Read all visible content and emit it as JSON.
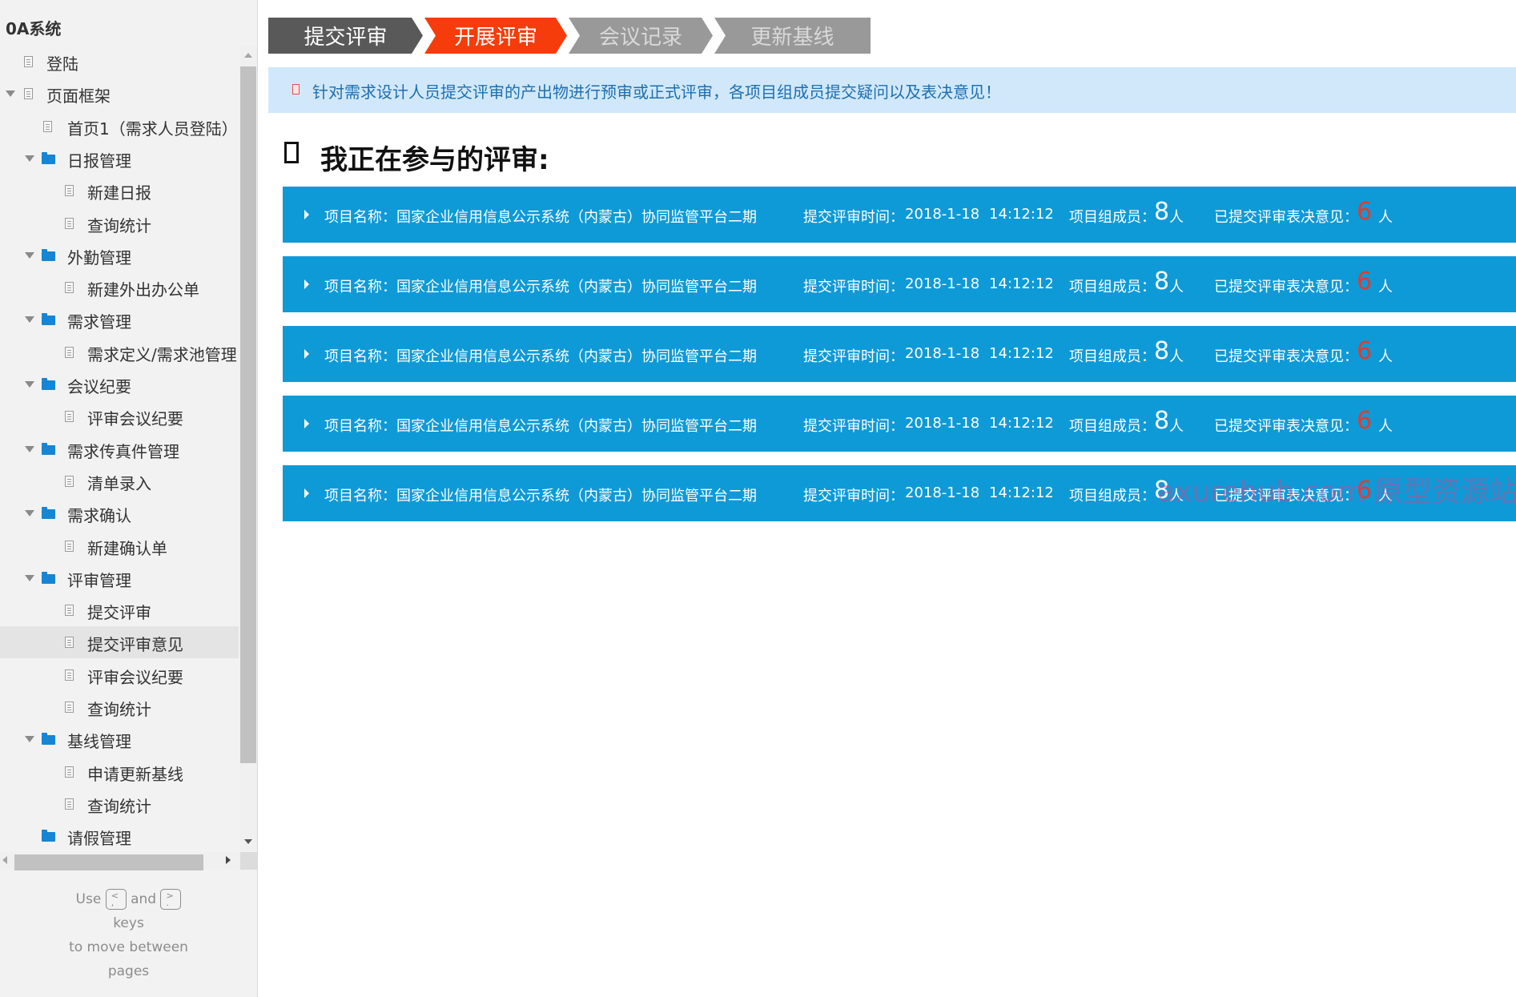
{
  "sidebar": {
    "title": "0A系统",
    "items": [
      {
        "label": "登陆",
        "type": "page",
        "level": 1,
        "expanded": null
      },
      {
        "label": "页面框架",
        "type": "page",
        "level": 1,
        "expanded": true
      },
      {
        "label": "首页1（需求人员登陆）",
        "type": "page",
        "level": 2,
        "expanded": null
      },
      {
        "label": "日报管理",
        "type": "folder",
        "level": 2,
        "expanded": true
      },
      {
        "label": "新建日报",
        "type": "page",
        "level": 3,
        "expanded": null
      },
      {
        "label": "查询统计",
        "type": "page",
        "level": 3,
        "expanded": null
      },
      {
        "label": "外勤管理",
        "type": "folder",
        "level": 2,
        "expanded": true
      },
      {
        "label": "新建外出办公单",
        "type": "page",
        "level": 3,
        "expanded": null
      },
      {
        "label": "需求管理",
        "type": "folder",
        "level": 2,
        "expanded": true
      },
      {
        "label": "需求定义/需求池管理",
        "type": "page",
        "level": 3,
        "expanded": null
      },
      {
        "label": "会议纪要",
        "type": "folder",
        "level": 2,
        "expanded": true
      },
      {
        "label": "评审会议纪要",
        "type": "page",
        "level": 3,
        "expanded": null
      },
      {
        "label": "需求传真件管理",
        "type": "folder",
        "level": 2,
        "expanded": true
      },
      {
        "label": "清单录入",
        "type": "page",
        "level": 3,
        "expanded": null
      },
      {
        "label": "需求确认",
        "type": "folder",
        "level": 2,
        "expanded": true
      },
      {
        "label": "新建确认单",
        "type": "page",
        "level": 3,
        "expanded": null
      },
      {
        "label": "评审管理",
        "type": "folder",
        "level": 2,
        "expanded": true
      },
      {
        "label": "提交评审",
        "type": "page",
        "level": 3,
        "expanded": null
      },
      {
        "label": "提交评审意见",
        "type": "page",
        "level": 3,
        "expanded": null,
        "selected": true
      },
      {
        "label": "评审会议纪要",
        "type": "page",
        "level": 3,
        "expanded": null
      },
      {
        "label": "查询统计",
        "type": "page",
        "level": 3,
        "expanded": null
      },
      {
        "label": "基线管理",
        "type": "folder",
        "level": 2,
        "expanded": true
      },
      {
        "label": "申请更新基线",
        "type": "page",
        "level": 3,
        "expanded": null
      },
      {
        "label": "查询统计",
        "type": "page",
        "level": 3,
        "expanded": null
      },
      {
        "label": "请假管理",
        "type": "folder",
        "level": 2,
        "expanded": false
      }
    ],
    "help": {
      "use": "Use",
      "key_prev": "<\n,",
      "and": "and",
      "key_next": ">\n.",
      "keys": "keys",
      "line2": "to move between",
      "line3": "pages"
    }
  },
  "steps": [
    {
      "label": "提交评审",
      "state": "done",
      "color": "#595959",
      "text_color": "#ffffff"
    },
    {
      "label": "开展评审",
      "state": "active",
      "color": "#f53c0a",
      "text_color": "#ffffff"
    },
    {
      "label": "会议记录",
      "state": "pending",
      "color": "#999999",
      "text_color": "#d9d9d9"
    },
    {
      "label": "更新基线",
      "state": "pending",
      "color": "#999999",
      "text_color": "#d9d9d9"
    }
  ],
  "info": {
    "text": "针对需求设计人员提交评审的产出物进行预审或正式评审，各项目组成员提交疑问以及表决意见！"
  },
  "section": {
    "title": "我正在参与的评审:"
  },
  "reviews": [
    {
      "project_label": "项目名称：",
      "project_name": "国家企业信用信息公示系统（内蒙古）协同监管平台二期",
      "time_label": "提交评审时间：",
      "date": "2018-1-18",
      "time": "14:12:12",
      "members_label": "项目组成员：",
      "members": "8",
      "members_unit": "人",
      "opinions_label": "已提交评审表决意见：",
      "opinions": "6",
      "opinions_unit": "人"
    },
    {
      "project_label": "项目名称：",
      "project_name": "国家企业信用信息公示系统（内蒙古）协同监管平台二期",
      "time_label": "提交评审时间：",
      "date": "2018-1-18",
      "time": "14:12:12",
      "members_label": "项目组成员：",
      "members": "8",
      "members_unit": "人",
      "opinions_label": "已提交评审表决意见：",
      "opinions": "6",
      "opinions_unit": "人"
    },
    {
      "project_label": "项目名称：",
      "project_name": "国家企业信用信息公示系统（内蒙古）协同监管平台二期",
      "time_label": "提交评审时间：",
      "date": "2018-1-18",
      "time": "14:12:12",
      "members_label": "项目组成员：",
      "members": "8",
      "members_unit": "人",
      "opinions_label": "已提交评审表决意见：",
      "opinions": "6",
      "opinions_unit": "人"
    },
    {
      "project_label": "项目名称：",
      "project_name": "国家企业信用信息公示系统（内蒙古）协同监管平台二期",
      "time_label": "提交评审时间：",
      "date": "2018-1-18",
      "time": "14:12:12",
      "members_label": "项目组成员：",
      "members": "8",
      "members_unit": "人",
      "opinions_label": "已提交评审表决意见：",
      "opinions": "6",
      "opinions_unit": "人"
    },
    {
      "project_label": "项目名称：",
      "project_name": "国家企业信用信息公示系统（内蒙古）协同监管平台二期",
      "time_label": "提交评审时间：",
      "date": "2018-1-18",
      "time": "14:12:12",
      "members_label": "项目组成员：",
      "members": "8",
      "members_unit": "人",
      "opinions_label": "已提交评审表决意见：",
      "opinions": "6",
      "opinions_unit": "人"
    }
  ],
  "colors": {
    "review_row": "#0e9ad7",
    "info_bg": "#d1e8fb",
    "info_text": "#1e6fb0",
    "highlight_number": "#e23b2e",
    "folder": "#1685d4"
  },
  "watermark": "axurehub.com 原型资源站"
}
